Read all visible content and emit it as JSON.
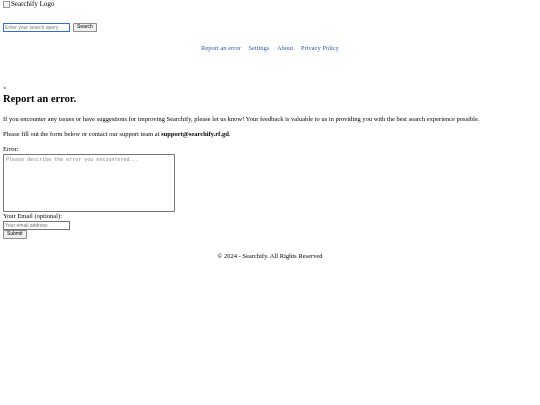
{
  "header": {
    "logo_alt": "Searchify Logo"
  },
  "search": {
    "placeholder": "Enter your search query",
    "value": "",
    "button_label": "Search"
  },
  "nav": {
    "links": [
      {
        "label": "Report an error"
      },
      {
        "label": "Settings"
      },
      {
        "label": "About"
      },
      {
        "label": "Privacy Policy"
      }
    ],
    "link_color": "#2b5bb8"
  },
  "report": {
    "close_symbol": "×",
    "title": "Report an error.",
    "intro": "If you encounter any issues or have suggestions for improving Searchify, please let us know! Your feedback is valuable to us in providing you with the best search experience possible.",
    "contact_prefix": "Please fill out the form below or contact our support team at ",
    "support_email": "support@searchify.rf.gd",
    "contact_suffix": ".",
    "error_label": "Error:",
    "error_placeholder": "Please describe the error you encountered...",
    "email_label": "Your Email (optional):",
    "email_placeholder": "Your email address",
    "submit_label": "Submit"
  },
  "footer": {
    "text": "© 2024 - Searchify. All Rights Reserved"
  }
}
